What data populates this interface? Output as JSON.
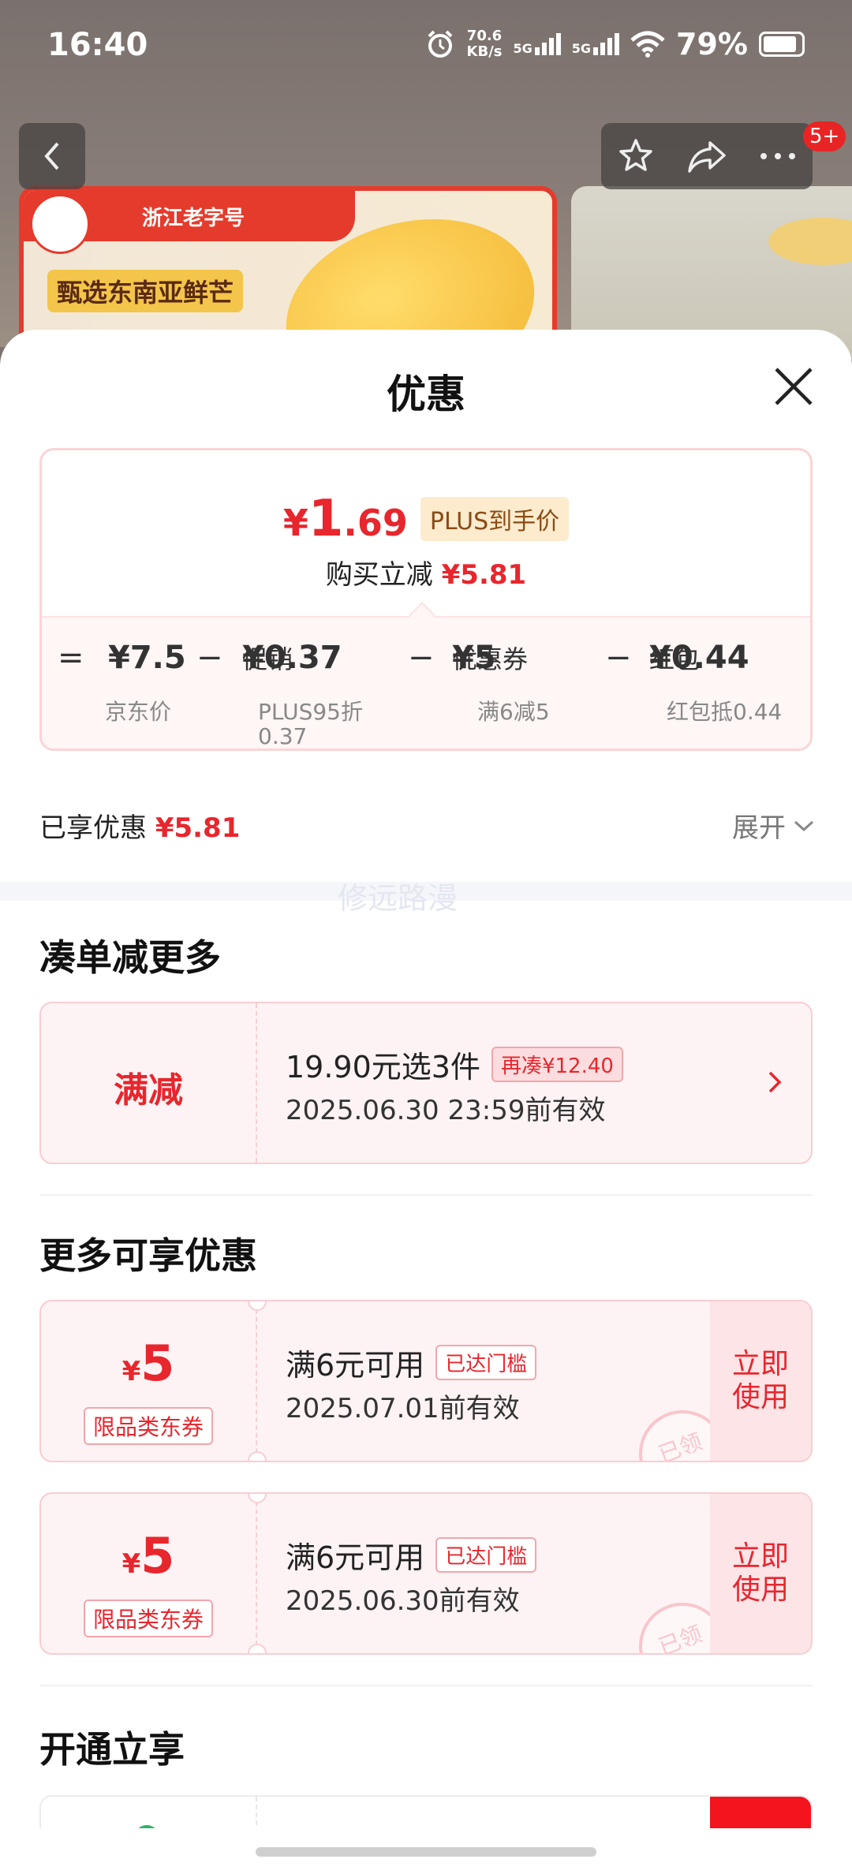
{
  "status_bar": {
    "time": "16:40",
    "net_speed_value": "70.6",
    "net_speed_unit": "KB/s",
    "sim1": "5G",
    "sim2": "5G",
    "battery": "79%"
  },
  "background_page": {
    "cart_badge": "5+",
    "banner_brand": "浙江老字号",
    "banner_slogan": "甄选东南亚鲜芒"
  },
  "sheet": {
    "title": "优惠",
    "summary": {
      "price_symbol": "¥",
      "price_int": "1",
      "price_dec": ".69",
      "price_tag": "PLUS到手价",
      "save_label": "购买立减",
      "save_amount": "¥5.81"
    },
    "calc": {
      "eq": "=",
      "jd_price": "¥7.5",
      "jd_price_label": "京东价",
      "minus": "−",
      "promo_label": "促销",
      "promo_amount": "¥0.37",
      "promo_sub_1": "PLUS95折",
      "promo_sub_2": "0.37",
      "coupon_label": "优惠券",
      "coupon_amount": "¥5",
      "coupon_sub": "满6减5",
      "redpacket_label": "红包",
      "redpacket_amount": "¥0.44",
      "redpacket_sub": "红包抵0.44"
    },
    "enjoyed_label": "已享优惠",
    "enjoyed_amount": "¥5.81",
    "expand_label": "展开",
    "watermark": "修远路漫"
  },
  "section_bundle": {
    "title": "凑单减更多",
    "card": {
      "left_label": "满减",
      "title": "19.90元选3件",
      "pill": "再凑¥12.40",
      "validity": "2025.06.30 23:59前有效"
    }
  },
  "section_more": {
    "title": "更多可享优惠",
    "coupons": [
      {
        "symbol": "¥",
        "amount": "5",
        "type": "限品类东券",
        "title": "满6元可用",
        "pill": "已达门槛",
        "validity": "2025.07.01前有效",
        "button": "立即使用",
        "stamp": "已领"
      },
      {
        "symbol": "¥",
        "amount": "5",
        "type": "限品类东券",
        "title": "满6元可用",
        "pill": "已达门槛",
        "validity": "2025.06.30前有效",
        "button": "立即使用",
        "stamp": "已领"
      }
    ]
  },
  "section_open": {
    "title": "开通立享"
  },
  "colors": {
    "accent_red": "#e8262d",
    "pill_border": "#f4a5ab",
    "card_bg": "#fdf3f4"
  }
}
